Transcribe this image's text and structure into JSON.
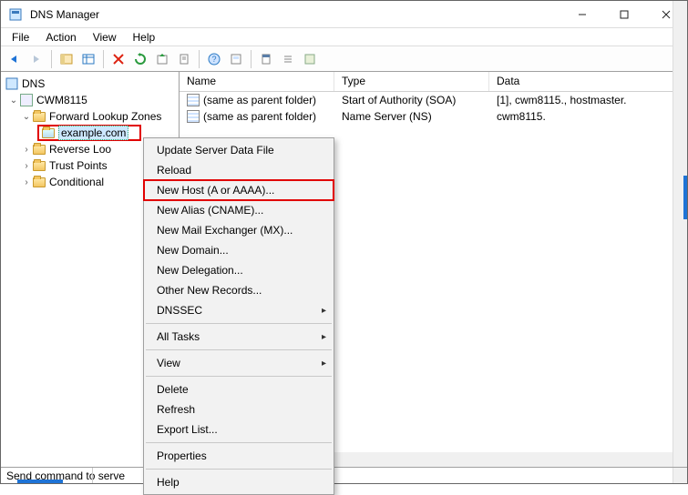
{
  "title": "DNS Manager",
  "menubar": {
    "file": "File",
    "action": "Action",
    "view": "View",
    "help": "Help"
  },
  "tree": {
    "root": "DNS",
    "server": "CWM8115",
    "zone_folder": "Forward Lookup Zones",
    "zone_selected": "example.com",
    "peer1": "Reverse Loo",
    "peer2": "Trust Points",
    "peer3": "Conditional"
  },
  "columns": {
    "name": "Name",
    "type": "Type",
    "data": "Data"
  },
  "rows": [
    {
      "name": "(same as parent folder)",
      "type": "Start of Authority (SOA)",
      "data": "[1], cwm8115., hostmaster."
    },
    {
      "name": "(same as parent folder)",
      "type": "Name Server (NS)",
      "data": "cwm8115."
    }
  ],
  "context_menu": {
    "update": "Update Server Data File",
    "reload": "Reload",
    "new_host": "New Host (A or AAAA)...",
    "new_alias": "New Alias (CNAME)...",
    "new_mx": "New Mail Exchanger (MX)...",
    "new_domain": "New Domain...",
    "new_delegation": "New Delegation...",
    "other_records": "Other New Records...",
    "dnssec": "DNSSEC",
    "all_tasks": "All Tasks",
    "view": "View",
    "delete": "Delete",
    "refresh": "Refresh",
    "export": "Export List...",
    "properties": "Properties",
    "help": "Help"
  },
  "statusbar": "Send command to serve"
}
